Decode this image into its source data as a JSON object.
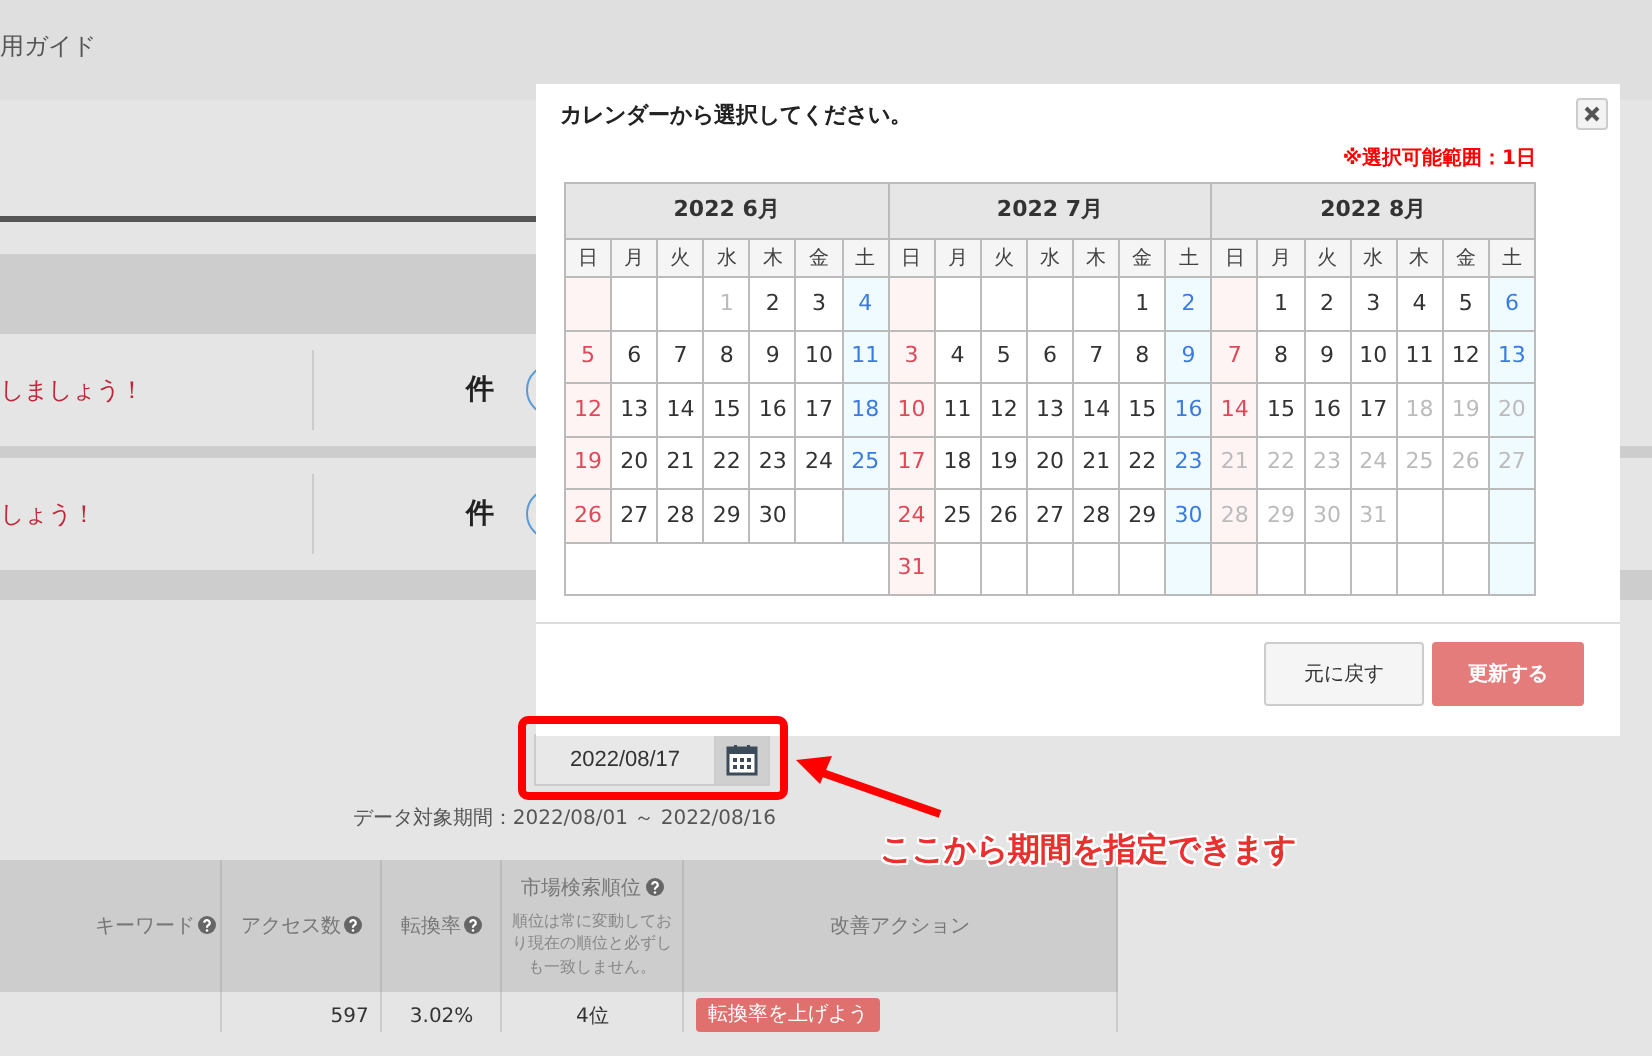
{
  "header": {
    "nav_text": "用ガイド"
  },
  "notices": [
    {
      "message": "しましょう！",
      "unit": "件"
    },
    {
      "message": "しょう！",
      "unit": "件"
    }
  ],
  "date_picker": {
    "value": "2022/08/17"
  },
  "data_period": "データ対象期間：2022/08/01 ～ 2022/08/16",
  "table": {
    "columns": [
      {
        "label": "キーワード",
        "help": true
      },
      {
        "label": "アクセス数",
        "help": true
      },
      {
        "label": "転換率",
        "help": true
      },
      {
        "label": "市場検索順位",
        "help": true,
        "note": "順位は常に変動しており現在の順位と必ずしも一致しません。"
      },
      {
        "label": "改善アクション",
        "help": false
      }
    ],
    "rows": [
      {
        "access": "597",
        "conversion": "3.02%",
        "rank": "4位",
        "action": "転換率を上げよう"
      }
    ]
  },
  "modal": {
    "title": "カレンダーから選択してください。",
    "note": "※選択可能範囲：1日",
    "months": [
      {
        "title": "2022 6月",
        "weekdays": [
          "日",
          "月",
          "火",
          "水",
          "木",
          "金",
          "土"
        ],
        "weeks": [
          [
            {
              "kind": "empty"
            },
            {
              "kind": "empty"
            },
            {
              "kind": "empty"
            },
            {
              "kind": "day",
              "day": "1",
              "disabled": true
            },
            {
              "kind": "day",
              "day": "2",
              "disabled": false
            },
            {
              "kind": "day",
              "day": "3",
              "disabled": false
            },
            {
              "kind": "day",
              "day": "4",
              "disabled": false
            }
          ],
          [
            {
              "kind": "day",
              "day": "5",
              "disabled": false
            },
            {
              "kind": "day",
              "day": "6",
              "disabled": false
            },
            {
              "kind": "day",
              "day": "7",
              "disabled": false
            },
            {
              "kind": "day",
              "day": "8",
              "disabled": false
            },
            {
              "kind": "day",
              "day": "9",
              "disabled": false
            },
            {
              "kind": "day",
              "day": "10",
              "disabled": false
            },
            {
              "kind": "day",
              "day": "11",
              "disabled": false
            }
          ],
          [
            {
              "kind": "day",
              "day": "12",
              "disabled": false
            },
            {
              "kind": "day",
              "day": "13",
              "disabled": false
            },
            {
              "kind": "day",
              "day": "14",
              "disabled": false
            },
            {
              "kind": "day",
              "day": "15",
              "disabled": false
            },
            {
              "kind": "day",
              "day": "16",
              "disabled": false
            },
            {
              "kind": "day",
              "day": "17",
              "disabled": false
            },
            {
              "kind": "day",
              "day": "18",
              "disabled": false
            }
          ],
          [
            {
              "kind": "day",
              "day": "19",
              "disabled": false
            },
            {
              "kind": "day",
              "day": "20",
              "disabled": false
            },
            {
              "kind": "day",
              "day": "21",
              "disabled": false
            },
            {
              "kind": "day",
              "day": "22",
              "disabled": false
            },
            {
              "kind": "day",
              "day": "23",
              "disabled": false
            },
            {
              "kind": "day",
              "day": "24",
              "disabled": false
            },
            {
              "kind": "day",
              "day": "25",
              "disabled": false
            }
          ],
          [
            {
              "kind": "day",
              "day": "26",
              "disabled": false
            },
            {
              "kind": "day",
              "day": "27",
              "disabled": false
            },
            {
              "kind": "day",
              "day": "28",
              "disabled": false
            },
            {
              "kind": "day",
              "day": "29",
              "disabled": false
            },
            {
              "kind": "day",
              "day": "30",
              "disabled": false
            },
            {
              "kind": "empty"
            },
            {
              "kind": "empty"
            }
          ]
        ]
      },
      {
        "title": "2022 7月",
        "weekdays": [
          "日",
          "月",
          "火",
          "水",
          "木",
          "金",
          "土"
        ],
        "weeks": [
          [
            {
              "kind": "empty"
            },
            {
              "kind": "empty"
            },
            {
              "kind": "empty"
            },
            {
              "kind": "empty"
            },
            {
              "kind": "empty"
            },
            {
              "kind": "day",
              "day": "1",
              "disabled": false
            },
            {
              "kind": "day",
              "day": "2",
              "disabled": false
            }
          ],
          [
            {
              "kind": "day",
              "day": "3",
              "disabled": false
            },
            {
              "kind": "day",
              "day": "4",
              "disabled": false
            },
            {
              "kind": "day",
              "day": "5",
              "disabled": false
            },
            {
              "kind": "day",
              "day": "6",
              "disabled": false
            },
            {
              "kind": "day",
              "day": "7",
              "disabled": false
            },
            {
              "kind": "day",
              "day": "8",
              "disabled": false
            },
            {
              "kind": "day",
              "day": "9",
              "disabled": false
            }
          ],
          [
            {
              "kind": "day",
              "day": "10",
              "disabled": false
            },
            {
              "kind": "day",
              "day": "11",
              "disabled": false
            },
            {
              "kind": "day",
              "day": "12",
              "disabled": false
            },
            {
              "kind": "day",
              "day": "13",
              "disabled": false
            },
            {
              "kind": "day",
              "day": "14",
              "disabled": false
            },
            {
              "kind": "day",
              "day": "15",
              "disabled": false
            },
            {
              "kind": "day",
              "day": "16",
              "disabled": false
            }
          ],
          [
            {
              "kind": "day",
              "day": "17",
              "disabled": false
            },
            {
              "kind": "day",
              "day": "18",
              "disabled": false
            },
            {
              "kind": "day",
              "day": "19",
              "disabled": false
            },
            {
              "kind": "day",
              "day": "20",
              "disabled": false
            },
            {
              "kind": "day",
              "day": "21",
              "disabled": false
            },
            {
              "kind": "day",
              "day": "22",
              "disabled": false
            },
            {
              "kind": "day",
              "day": "23",
              "disabled": false
            }
          ],
          [
            {
              "kind": "day",
              "day": "24",
              "disabled": false
            },
            {
              "kind": "day",
              "day": "25",
              "disabled": false
            },
            {
              "kind": "day",
              "day": "26",
              "disabled": false
            },
            {
              "kind": "day",
              "day": "27",
              "disabled": false
            },
            {
              "kind": "day",
              "day": "28",
              "disabled": false
            },
            {
              "kind": "day",
              "day": "29",
              "disabled": false
            },
            {
              "kind": "day",
              "day": "30",
              "disabled": false
            }
          ],
          [
            {
              "kind": "day",
              "day": "31",
              "disabled": false
            },
            {
              "kind": "empty"
            },
            {
              "kind": "empty"
            },
            {
              "kind": "empty"
            },
            {
              "kind": "empty"
            },
            {
              "kind": "empty"
            },
            {
              "kind": "empty"
            }
          ]
        ]
      },
      {
        "title": "2022 8月",
        "weekdays": [
          "日",
          "月",
          "火",
          "水",
          "木",
          "金",
          "土"
        ],
        "weeks": [
          [
            {
              "kind": "empty"
            },
            {
              "kind": "day",
              "day": "1",
              "disabled": false
            },
            {
              "kind": "day",
              "day": "2",
              "disabled": false
            },
            {
              "kind": "day",
              "day": "3",
              "disabled": false
            },
            {
              "kind": "day",
              "day": "4",
              "disabled": false
            },
            {
              "kind": "day",
              "day": "5",
              "disabled": false
            },
            {
              "kind": "day",
              "day": "6",
              "disabled": false
            }
          ],
          [
            {
              "kind": "day",
              "day": "7",
              "disabled": false
            },
            {
              "kind": "day",
              "day": "8",
              "disabled": false
            },
            {
              "kind": "day",
              "day": "9",
              "disabled": false
            },
            {
              "kind": "day",
              "day": "10",
              "disabled": false
            },
            {
              "kind": "day",
              "day": "11",
              "disabled": false
            },
            {
              "kind": "day",
              "day": "12",
              "disabled": false
            },
            {
              "kind": "day",
              "day": "13",
              "disabled": false
            }
          ],
          [
            {
              "kind": "day",
              "day": "14",
              "disabled": false
            },
            {
              "kind": "day",
              "day": "15",
              "disabled": false
            },
            {
              "kind": "day",
              "day": "16",
              "disabled": false
            },
            {
              "kind": "day",
              "day": "17",
              "disabled": false
            },
            {
              "kind": "day",
              "day": "18",
              "disabled": true
            },
            {
              "kind": "day",
              "day": "19",
              "disabled": true
            },
            {
              "kind": "day",
              "day": "20",
              "disabled": true
            }
          ],
          [
            {
              "kind": "day",
              "day": "21",
              "disabled": true
            },
            {
              "kind": "day",
              "day": "22",
              "disabled": true
            },
            {
              "kind": "day",
              "day": "23",
              "disabled": true
            },
            {
              "kind": "day",
              "day": "24",
              "disabled": true
            },
            {
              "kind": "day",
              "day": "25",
              "disabled": true
            },
            {
              "kind": "day",
              "day": "26",
              "disabled": true
            },
            {
              "kind": "day",
              "day": "27",
              "disabled": true
            }
          ],
          [
            {
              "kind": "day",
              "day": "28",
              "disabled": true
            },
            {
              "kind": "day",
              "day": "29",
              "disabled": true
            },
            {
              "kind": "day",
              "day": "30",
              "disabled": true
            },
            {
              "kind": "day",
              "day": "31",
              "disabled": true
            },
            {
              "kind": "empty"
            },
            {
              "kind": "empty"
            },
            {
              "kind": "empty"
            }
          ],
          [
            {
              "kind": "empty"
            },
            {
              "kind": "empty"
            },
            {
              "kind": "empty"
            },
            {
              "kind": "empty"
            },
            {
              "kind": "empty"
            },
            {
              "kind": "empty"
            },
            {
              "kind": "empty"
            }
          ]
        ]
      }
    ],
    "buttons": [
      {
        "label": "元に戻す",
        "kind": "secondary"
      },
      {
        "label": "更新する",
        "kind": "primary"
      }
    ]
  },
  "annotation": {
    "text": "ここから期間を指定できます"
  }
}
